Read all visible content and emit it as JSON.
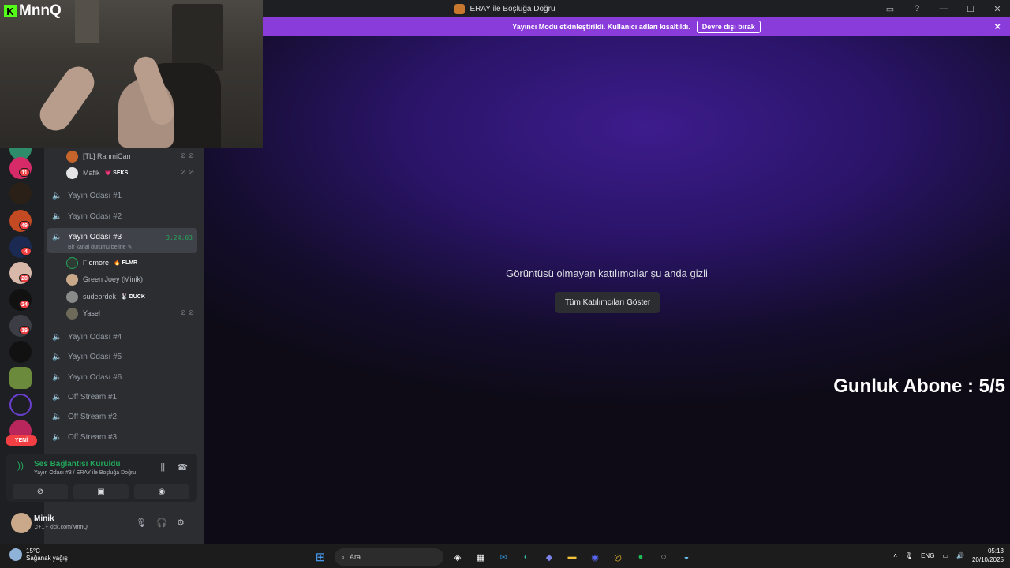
{
  "window": {
    "title": "ERAY ile Boşluğa Doğru"
  },
  "streamer_bar": {
    "message": "Yayıncı Modu etkinleştirildi. Kullanıcı adları kısaltıldı.",
    "disable_label": "Devre dışı bırak",
    "close_icon": "×"
  },
  "webcam": {
    "logo_k": "K",
    "logo_text": "MnnQ"
  },
  "rail": {
    "badges": [
      "11",
      "49",
      "4",
      "28",
      "24",
      "19"
    ],
    "new_label": "YENİ"
  },
  "voice_channel_top": {
    "members": [
      {
        "name": "[TL] RahmiCan",
        "tag": "",
        "muted": true
      },
      {
        "name": "Mafik",
        "tag": "💗 SEKS",
        "muted": true
      }
    ]
  },
  "channels": [
    {
      "name": "Yayın Odası #1"
    },
    {
      "name": "Yayın Odası #2"
    },
    {
      "name": "Yayın Odası #3",
      "active": true,
      "timer": "3:24:03",
      "status": "Bir kanal durumu belirle ✎"
    },
    {
      "name": "Yayın Odası #4"
    },
    {
      "name": "Yayın Odası #5"
    },
    {
      "name": "Yayın Odası #6"
    },
    {
      "name": "Off Stream #1"
    },
    {
      "name": "Off Stream #2"
    },
    {
      "name": "Off Stream #3"
    }
  ],
  "active_members": [
    {
      "name": "Flomore",
      "tag": "🔥 FLMR",
      "muted": false
    },
    {
      "name": "Green Joey (Minik)",
      "tag": "",
      "muted": false
    },
    {
      "name": "sudeordek",
      "tag": "🐰 DUCK",
      "muted": false
    },
    {
      "name": "Yasel",
      "tag": "",
      "muted": true
    }
  ],
  "voice_panel": {
    "title": "Ses Bağlantısı Kuruldu",
    "subtitle": "Yayın Odası #3 / ERAY ile Boşluğa Doğru"
  },
  "user_panel": {
    "name": "Minik",
    "status": "♫+1 • kick.com/MnnQ"
  },
  "main": {
    "hidden_message": "Görüntüsü olmayan katılımcılar şu anda gizli",
    "show_all_label": "Tüm Katılımcıları Göster",
    "sub_overlay": "Gunluk Abone : 5/5"
  },
  "taskbar": {
    "temperature": "15°C",
    "condition": "Sağanak yağış",
    "search_placeholder": "Ara",
    "language": "ENG",
    "time": "05:13",
    "date": "20/10/2025"
  },
  "colors": {
    "streamer_bar": "#8a3cdb",
    "accent_green": "#23a55a",
    "badge_red": "#f23f43"
  }
}
